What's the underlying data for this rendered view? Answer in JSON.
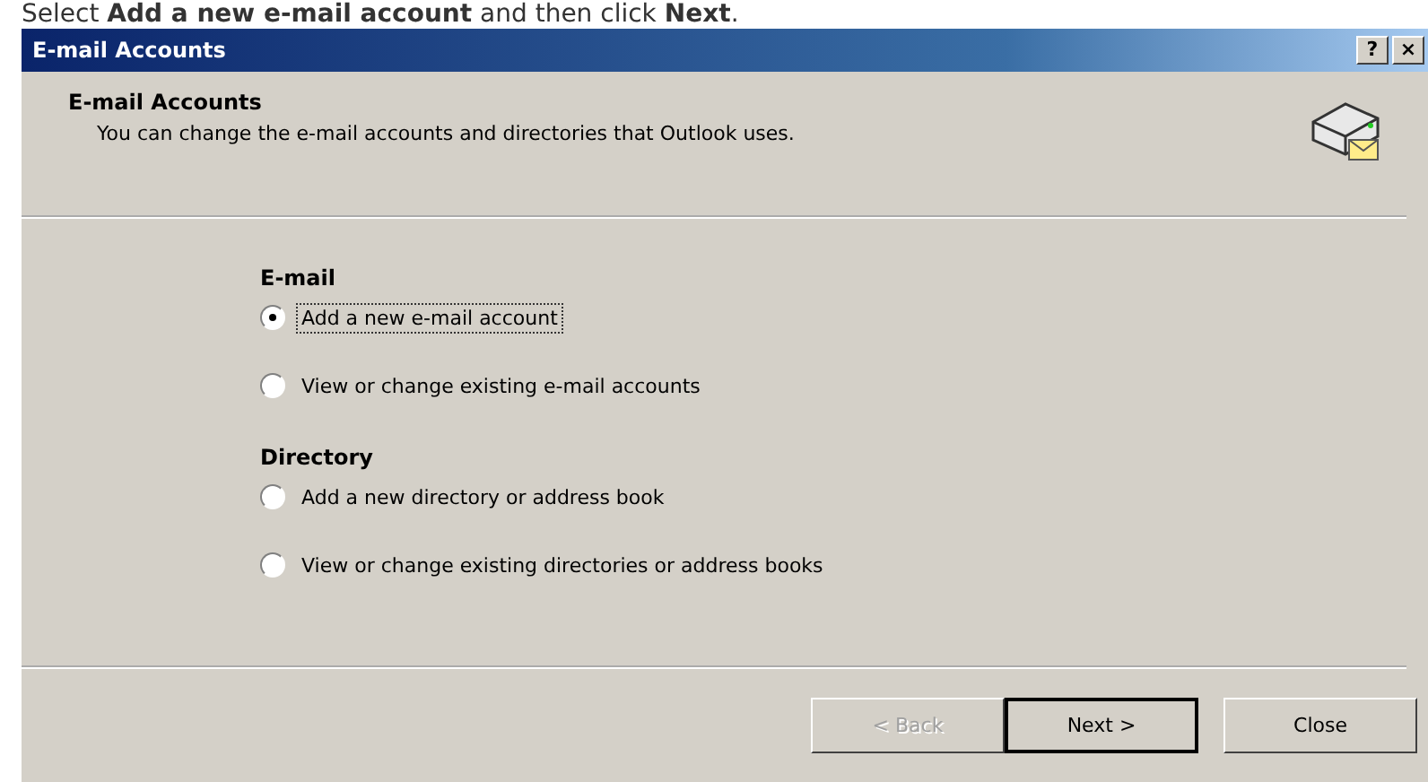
{
  "caption": "Select **Add a new e-mail account** and then click **Next**.",
  "window": {
    "title": "E-mail Accounts",
    "title_buttons": [
      "?",
      "×"
    ]
  },
  "header": {
    "title": "E-mail Accounts",
    "subtitle": "You can change the e-mail accounts and directories that Outlook uses."
  },
  "groups": [
    {
      "label": "E-mail",
      "options": [
        {
          "label": "Add a new e-mail account",
          "selected": true
        },
        {
          "label": "View or change existing e-mail accounts",
          "selected": false
        }
      ]
    },
    {
      "label": "Directory",
      "options": [
        {
          "label": "Add a new directory or address book",
          "selected": false
        },
        {
          "label": "View or change existing directories or address books",
          "selected": false
        }
      ]
    }
  ],
  "buttons": [
    {
      "label": "< Back",
      "disabled": true,
      "default": false
    },
    {
      "label": "Next >",
      "disabled": false,
      "default": true
    },
    {
      "label": "Close",
      "disabled": false,
      "default": false
    }
  ]
}
